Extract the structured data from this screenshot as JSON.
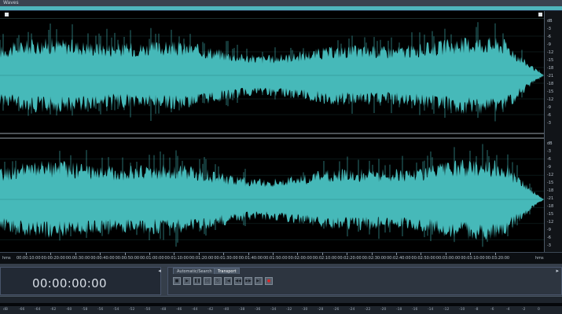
{
  "window": {
    "tab_label": "Waves"
  },
  "editor": {
    "db_scale_top": [
      "dB",
      "-3",
      "-6",
      "-9",
      "-12",
      "-15",
      "-18",
      "-21",
      "-18",
      "-15",
      "-12",
      "-9",
      "-6",
      "-3"
    ],
    "db_scale_bottom": [
      "dB",
      "-3",
      "-6",
      "-9",
      "-12",
      "-15",
      "-18",
      "-21",
      "-18",
      "-15",
      "-12",
      "-9",
      "-6",
      "-3"
    ],
    "time_start": "hms",
    "time_labels": [
      "00:00:10:00",
      "00:00:20:00",
      "00:00:30:00",
      "00:00:40:00",
      "00:00:50:00",
      "00:01:00:00",
      "00:01:10:00",
      "00:01:20:00",
      "00:01:30:00",
      "00:01:40:00",
      "00:01:50:00",
      "00:02:00:00",
      "00:02:10:00",
      "00:02:20:00",
      "00:02:30:00",
      "00:02:40:00",
      "00:02:50:00",
      "00:03:00:00",
      "00:03:10:00",
      "00:03:20:00"
    ],
    "time_end": "hms",
    "waveform_color": "#46b9b9"
  },
  "time_panel": {
    "display": "00:00:00:00"
  },
  "transport": {
    "tabs": [
      "Automatic/Search",
      "Transport"
    ],
    "buttons": [
      {
        "name": "stop-button",
        "icon": "■"
      },
      {
        "name": "play-button",
        "icon": "▶"
      },
      {
        "name": "pause-button",
        "icon": "❚❚"
      },
      {
        "name": "play-to-end-button",
        "icon": "▷|"
      },
      {
        "name": "loop-button",
        "icon": "↻"
      },
      {
        "name": "go-to-start-button",
        "icon": "|◀"
      },
      {
        "name": "rewind-button",
        "icon": "◀◀"
      },
      {
        "name": "fast-forward-button",
        "icon": "▶▶"
      },
      {
        "name": "go-to-end-button",
        "icon": "▶|"
      },
      {
        "name": "record-button",
        "icon": "●"
      }
    ]
  },
  "level_meter": {
    "labels": [
      "dB",
      "-66",
      "-64",
      "-62",
      "-60",
      "-58",
      "-56",
      "-54",
      "-52",
      "-50",
      "-48",
      "-46",
      "-44",
      "-42",
      "-40",
      "-38",
      "-36",
      "-34",
      "-32",
      "-30",
      "-28",
      "-26",
      "-24",
      "-22",
      "-20",
      "-18",
      "-16",
      "-14",
      "-12",
      "-10",
      "-8",
      "-6",
      "-4",
      "-2",
      "0"
    ]
  }
}
